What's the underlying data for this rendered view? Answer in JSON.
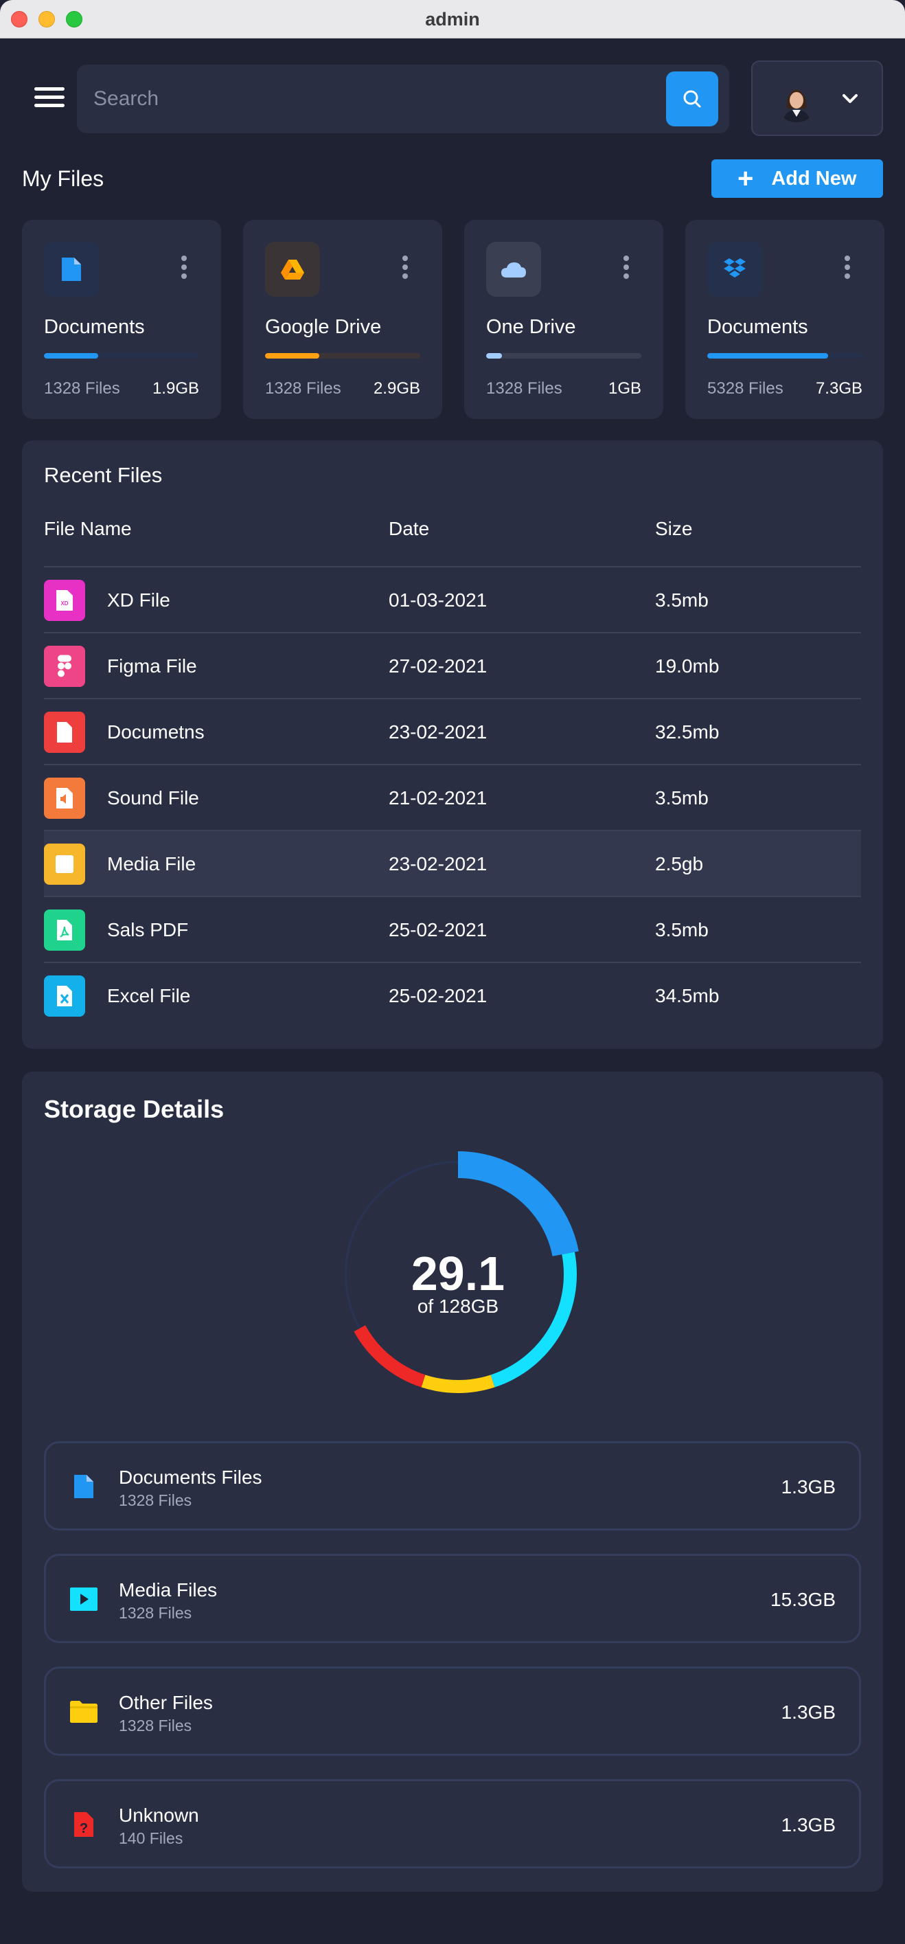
{
  "window": {
    "title": "admin"
  },
  "header": {
    "search_placeholder": "Search"
  },
  "my_files": {
    "title": "My Files",
    "add_label": "Add New",
    "cards": [
      {
        "name": "Documents",
        "files": "1328 Files",
        "size": "1.9GB",
        "progress": 0.35,
        "color": "#2196f3",
        "track": "#25304c",
        "icon": "document-icon"
      },
      {
        "name": "Google Drive",
        "files": "1328 Files",
        "size": "2.9GB",
        "progress": 0.35,
        "color": "#ffa113",
        "track": "#3d3436",
        "icon": "google-drive-icon"
      },
      {
        "name": "One Drive",
        "files": "1328 Files",
        "size": "1GB",
        "progress": 0.1,
        "color": "#a4cdff",
        "track": "#3a3f52",
        "icon": "cloud-icon"
      },
      {
        "name": "Documents",
        "files": "5328 Files",
        "size": "7.3GB",
        "progress": 0.78,
        "color": "#2196f3",
        "track": "#25304c",
        "icon": "dropbox-icon"
      }
    ]
  },
  "recent_files": {
    "title": "Recent Files",
    "columns": [
      "File Name",
      "Date",
      "Size"
    ],
    "rows": [
      {
        "name": "XD File",
        "date": "01-03-2021",
        "size": "3.5mb",
        "color": "#e631c4",
        "icon": "xd-file-icon"
      },
      {
        "name": "Figma File",
        "date": "27-02-2021",
        "size": "19.0mb",
        "color": "#ee4587",
        "icon": "figma-icon"
      },
      {
        "name": "Documetns",
        "date": "23-02-2021",
        "size": "32.5mb",
        "color": "#ee3e3e",
        "icon": "document-file-icon"
      },
      {
        "name": "Sound File",
        "date": "21-02-2021",
        "size": "3.5mb",
        "color": "#f47a3b",
        "icon": "sound-file-icon"
      },
      {
        "name": "Media File",
        "date": "23-02-2021",
        "size": "2.5gb",
        "color": "#f7b72d",
        "icon": "media-file-icon"
      },
      {
        "name": "Sals PDF",
        "date": "25-02-2021",
        "size": "3.5mb",
        "color": "#1fd38c",
        "icon": "pdf-file-icon"
      },
      {
        "name": "Excel File",
        "date": "25-02-2021",
        "size": "34.5mb",
        "color": "#13b0ec",
        "icon": "excel-file-icon"
      }
    ]
  },
  "storage": {
    "title": "Storage Details",
    "used": "29.1",
    "total_label": "of 128GB",
    "segments": [
      {
        "color": "#2196f3",
        "fraction": 0.22
      },
      {
        "color": "#14e0ff",
        "fraction": 0.23
      },
      {
        "color": "#ffcf0f",
        "fraction": 0.1
      },
      {
        "color": "#ee2727",
        "fraction": 0.12
      },
      {
        "color": "#293454",
        "fraction": 0.33
      }
    ],
    "items": [
      {
        "title": "Documents Files",
        "count": "1328 Files",
        "size": "1.3GB",
        "color": "#2196f3",
        "icon": "document-icon"
      },
      {
        "title": "Media Files",
        "count": "1328 Files",
        "size": "15.3GB",
        "color": "#14e0ff",
        "icon": "media-icon"
      },
      {
        "title": "Other Files",
        "count": "1328 Files",
        "size": "1.3GB",
        "color": "#ffcf0f",
        "icon": "folder-icon"
      },
      {
        "title": "Unknown",
        "count": "140 Files",
        "size": "1.3GB",
        "color": "#ee2727",
        "icon": "unknown-file-icon"
      }
    ]
  }
}
